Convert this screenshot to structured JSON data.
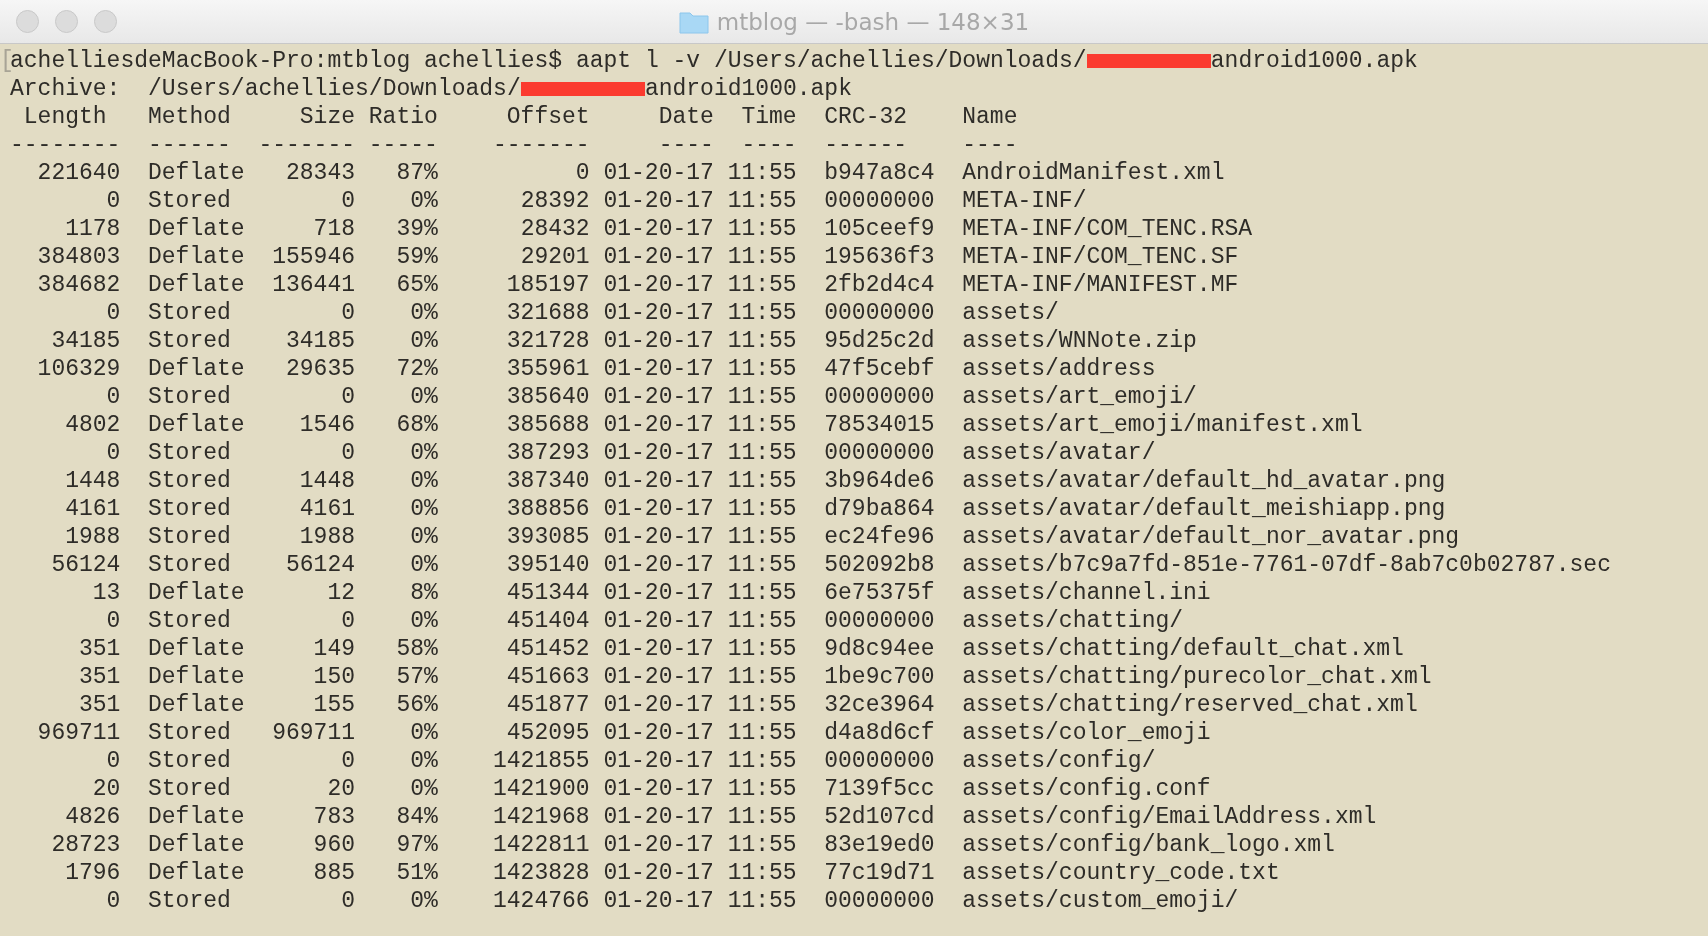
{
  "window": {
    "title": "mtblog — -bash — 148×31"
  },
  "terminal": {
    "mark": "[",
    "prompt_line": {
      "before": "achelliesdeMacBook-Pro:mtblog achellies$ aapt l -v /Users/achellies/Downloads/",
      "after": "android1000.apk"
    },
    "archive_line": {
      "before": "Archive:  /Users/achellies/Downloads/",
      "after": "android1000.apk"
    },
    "columns": [
      {
        "label": "Length",
        "rule": "--------"
      },
      {
        "label": "Method",
        "rule": "------"
      },
      {
        "label": "Size",
        "rule": "-------"
      },
      {
        "label": "Ratio",
        "rule": "-----"
      },
      {
        "label": "Offset",
        "rule": "-------"
      },
      {
        "label": "Date",
        "rule": "----"
      },
      {
        "label": "Time",
        "rule": "----"
      },
      {
        "label": "CRC-32",
        "rule": "------"
      },
      {
        "label": "Name",
        "rule": "----"
      }
    ],
    "rows": [
      [
        "221640",
        "Deflate",
        "28343",
        "87%",
        "0",
        "01-20-17",
        "11:55",
        "b947a8c4",
        "AndroidManifest.xml"
      ],
      [
        "0",
        "Stored",
        "0",
        "0%",
        "28392",
        "01-20-17",
        "11:55",
        "00000000",
        "META-INF/"
      ],
      [
        "1178",
        "Deflate",
        "718",
        "39%",
        "28432",
        "01-20-17",
        "11:55",
        "105ceef9",
        "META-INF/COM_TENC.RSA"
      ],
      [
        "384803",
        "Deflate",
        "155946",
        "59%",
        "29201",
        "01-20-17",
        "11:55",
        "195636f3",
        "META-INF/COM_TENC.SF"
      ],
      [
        "384682",
        "Deflate",
        "136441",
        "65%",
        "185197",
        "01-20-17",
        "11:55",
        "2fb2d4c4",
        "META-INF/MANIFEST.MF"
      ],
      [
        "0",
        "Stored",
        "0",
        "0%",
        "321688",
        "01-20-17",
        "11:55",
        "00000000",
        "assets/"
      ],
      [
        "34185",
        "Stored",
        "34185",
        "0%",
        "321728",
        "01-20-17",
        "11:55",
        "95d25c2d",
        "assets/WNNote.zip"
      ],
      [
        "106329",
        "Deflate",
        "29635",
        "72%",
        "355961",
        "01-20-17",
        "11:55",
        "47f5cebf",
        "assets/address"
      ],
      [
        "0",
        "Stored",
        "0",
        "0%",
        "385640",
        "01-20-17",
        "11:55",
        "00000000",
        "assets/art_emoji/"
      ],
      [
        "4802",
        "Deflate",
        "1546",
        "68%",
        "385688",
        "01-20-17",
        "11:55",
        "78534015",
        "assets/art_emoji/manifest.xml"
      ],
      [
        "0",
        "Stored",
        "0",
        "0%",
        "387293",
        "01-20-17",
        "11:55",
        "00000000",
        "assets/avatar/"
      ],
      [
        "1448",
        "Stored",
        "1448",
        "0%",
        "387340",
        "01-20-17",
        "11:55",
        "3b964de6",
        "assets/avatar/default_hd_avatar.png"
      ],
      [
        "4161",
        "Stored",
        "4161",
        "0%",
        "388856",
        "01-20-17",
        "11:55",
        "d79ba864",
        "assets/avatar/default_meishiapp.png"
      ],
      [
        "1988",
        "Stored",
        "1988",
        "0%",
        "393085",
        "01-20-17",
        "11:55",
        "ec24fe96",
        "assets/avatar/default_nor_avatar.png"
      ],
      [
        "56124",
        "Stored",
        "56124",
        "0%",
        "395140",
        "01-20-17",
        "11:55",
        "502092b8",
        "assets/b7c9a7fd-851e-7761-07df-8ab7c0b02787.sec"
      ],
      [
        "13",
        "Deflate",
        "12",
        "8%",
        "451344",
        "01-20-17",
        "11:55",
        "6e75375f",
        "assets/channel.ini"
      ],
      [
        "0",
        "Stored",
        "0",
        "0%",
        "451404",
        "01-20-17",
        "11:55",
        "00000000",
        "assets/chatting/"
      ],
      [
        "351",
        "Deflate",
        "149",
        "58%",
        "451452",
        "01-20-17",
        "11:55",
        "9d8c94ee",
        "assets/chatting/default_chat.xml"
      ],
      [
        "351",
        "Deflate",
        "150",
        "57%",
        "451663",
        "01-20-17",
        "11:55",
        "1be9c700",
        "assets/chatting/purecolor_chat.xml"
      ],
      [
        "351",
        "Deflate",
        "155",
        "56%",
        "451877",
        "01-20-17",
        "11:55",
        "32ce3964",
        "assets/chatting/reserved_chat.xml"
      ],
      [
        "969711",
        "Stored",
        "969711",
        "0%",
        "452095",
        "01-20-17",
        "11:55",
        "d4a8d6cf",
        "assets/color_emoji"
      ],
      [
        "0",
        "Stored",
        "0",
        "0%",
        "1421855",
        "01-20-17",
        "11:55",
        "00000000",
        "assets/config/"
      ],
      [
        "20",
        "Stored",
        "20",
        "0%",
        "1421900",
        "01-20-17",
        "11:55",
        "7139f5cc",
        "assets/config.conf"
      ],
      [
        "4826",
        "Deflate",
        "783",
        "84%",
        "1421968",
        "01-20-17",
        "11:55",
        "52d107cd",
        "assets/config/EmailAddress.xml"
      ],
      [
        "28723",
        "Deflate",
        "960",
        "97%",
        "1422811",
        "01-20-17",
        "11:55",
        "83e19ed0",
        "assets/config/bank_logo.xml"
      ],
      [
        "1796",
        "Deflate",
        "885",
        "51%",
        "1423828",
        "01-20-17",
        "11:55",
        "77c19d71",
        "assets/country_code.txt"
      ],
      [
        "0",
        "Stored",
        "0",
        "0%",
        "1424766",
        "01-20-17",
        "11:55",
        "00000000",
        "assets/custom_emoji/"
      ]
    ]
  }
}
